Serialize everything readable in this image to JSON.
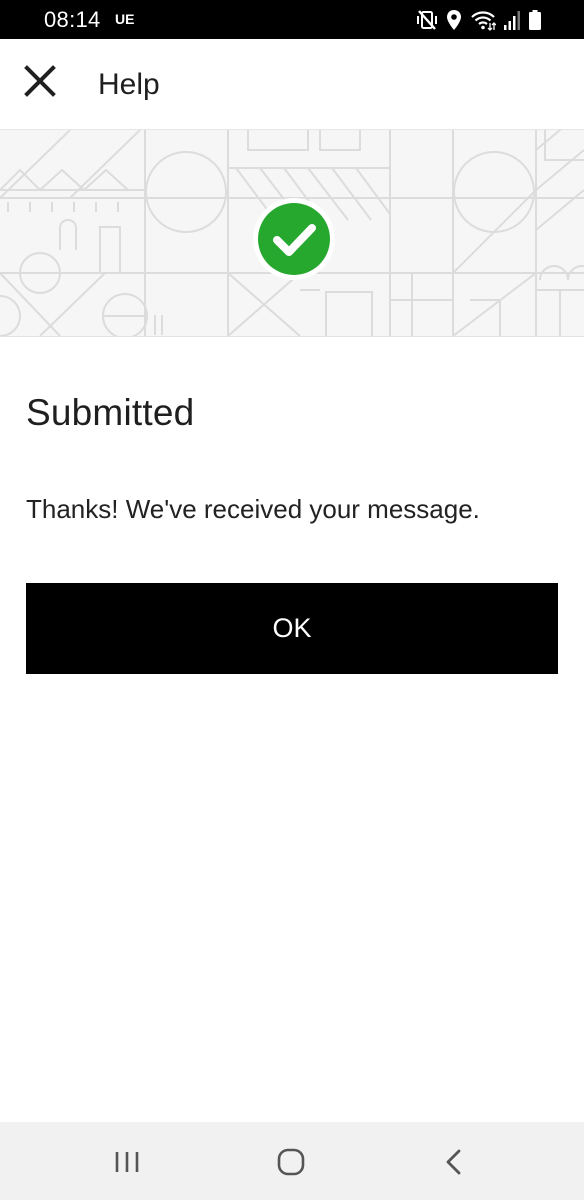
{
  "status_bar": {
    "time": "08:14",
    "carrier": "UE",
    "icons": [
      "mute-vibrate-icon",
      "location-icon",
      "wifi-icon",
      "signal-icon",
      "battery-icon"
    ]
  },
  "app_bar": {
    "title": "Help",
    "close_icon": "close-icon"
  },
  "banner": {
    "status_icon": "check-circle-icon",
    "accent_color": "#26a82f"
  },
  "content": {
    "heading": "Submitted",
    "message": "Thanks! We've received your message.",
    "ok_label": "OK"
  },
  "nav_bar": {
    "icons": [
      "recents-icon",
      "home-icon",
      "back-icon"
    ]
  },
  "colors": {
    "button_bg": "#000000",
    "status_bar_bg": "#000000",
    "nav_bar_bg": "#f1f1f1",
    "banner_bg": "#f6f6f6"
  }
}
